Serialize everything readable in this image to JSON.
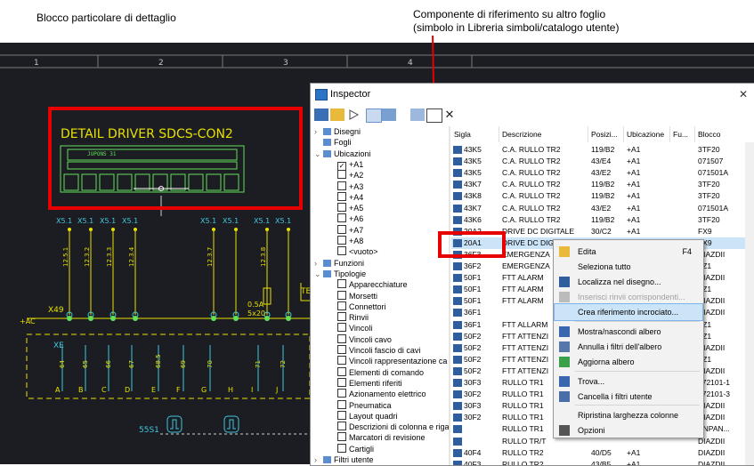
{
  "callouts": {
    "left": "Blocco particolare di dettaglio",
    "right_line1": "Componente di riferimento su altro foglio",
    "right_line2": "(simbolo in Libreria simboli/catalogo utente)"
  },
  "cad": {
    "ruler": [
      "1",
      "2",
      "3",
      "4"
    ],
    "detail_title": "DETAIL DRIVER SDCS-CON2",
    "detail_sub": [
      "JUPONS 31",
      "0.1",
      "16-11",
      "10.17",
      "16-1"
    ],
    "terminal_tags": [
      "X5.1",
      "X5.1",
      "X5.1",
      "X5.1",
      "X5.1",
      "X5.1",
      "X5.1",
      "X5.1"
    ],
    "wire_nums": [
      "12.5.1",
      "12.3.2",
      "12.3.3",
      "12.3.4",
      "12.3.7",
      "12.3.8"
    ],
    "x49": "X49",
    "xe": "XE",
    "ac": "+AC",
    "bot_nums": [
      "64",
      "65",
      "66",
      "67",
      "68.5",
      "69",
      "70",
      "71",
      "72"
    ],
    "bot_letters": [
      "A",
      "B",
      "C",
      "D",
      "E",
      "F",
      "G",
      "H",
      "I",
      "J"
    ],
    "fuse_label1": "0.5A",
    "fuse_label2": "5x20",
    "relay": "55S1",
    "side_te": "TE",
    "side_54": "54"
  },
  "inspector": {
    "title": "Inspector",
    "close": "✕",
    "tree": [
      {
        "label": "Disegni",
        "indent": 0,
        "exp": "›"
      },
      {
        "label": "Fogli",
        "indent": 0,
        "exp": ""
      },
      {
        "label": "Ubicazioni",
        "indent": 0,
        "exp": "⌄"
      },
      {
        "label": "+A1",
        "indent": 1,
        "checked": true
      },
      {
        "label": "+A2",
        "indent": 1
      },
      {
        "label": "+A3",
        "indent": 1
      },
      {
        "label": "+A4",
        "indent": 1
      },
      {
        "label": "+A5",
        "indent": 1
      },
      {
        "label": "+A6",
        "indent": 1
      },
      {
        "label": "+A7",
        "indent": 1
      },
      {
        "label": "+A8",
        "indent": 1
      },
      {
        "label": "<vuoto>",
        "indent": 1
      },
      {
        "label": "Funzioni",
        "indent": 0,
        "exp": "›"
      },
      {
        "label": "Tipologie",
        "indent": 0,
        "exp": "⌄"
      },
      {
        "label": "Apparecchiature",
        "indent": 1
      },
      {
        "label": "Morsetti",
        "indent": 1
      },
      {
        "label": "Connettori",
        "indent": 1
      },
      {
        "label": "Rinvii",
        "indent": 1
      },
      {
        "label": "Vincoli",
        "indent": 1
      },
      {
        "label": "Vincoli cavo",
        "indent": 1
      },
      {
        "label": "Vincoli fascio di cavi",
        "indent": 1
      },
      {
        "label": "Vincoli rappresentazione ca",
        "indent": 1
      },
      {
        "label": "Elementi di comando",
        "indent": 1
      },
      {
        "label": "Elementi riferiti",
        "indent": 1
      },
      {
        "label": "Azionamento elettrico",
        "indent": 1
      },
      {
        "label": "Pneumatica",
        "indent": 1
      },
      {
        "label": "Layout quadri",
        "indent": 1
      },
      {
        "label": "Descrizioni di colonna e riga",
        "indent": 1
      },
      {
        "label": "Marcatori di revisione",
        "indent": 1
      },
      {
        "label": "Cartigli",
        "indent": 1
      },
      {
        "label": "Filtri utente",
        "indent": 0,
        "exp": "›"
      }
    ],
    "columns": [
      "Sigla",
      "Descrizione",
      "Posizi...",
      "Ubicazione",
      "Fu...",
      "Blocco"
    ],
    "rows": [
      [
        "43K5",
        "C.A. RULLO TR2",
        "119/B2",
        "+A1",
        "",
        "3TF20"
      ],
      [
        "43K5",
        "C.A. RULLO TR2",
        "43/E4",
        "+A1",
        "",
        "071507"
      ],
      [
        "43K5",
        "C.A. RULLO TR2",
        "43/E2",
        "+A1",
        "",
        "071501A"
      ],
      [
        "43K7",
        "C.A. RULLO TR2",
        "119/B2",
        "+A1",
        "",
        "3TF20"
      ],
      [
        "43K8",
        "C.A. RULLO TR2",
        "119/B2",
        "+A1",
        "",
        "3TF20"
      ],
      [
        "43K7",
        "C.A. RULLO TR2",
        "43/E2",
        "+A1",
        "",
        "071501A"
      ],
      [
        "43K6",
        "C.A. RULLO TR2",
        "119/B2",
        "+A1",
        "",
        "3TF20"
      ],
      [
        "20A2",
        "DRIVE DC DIGITALE",
        "30/C2",
        "+A1",
        "",
        "FX9"
      ],
      [
        "20A1",
        "DRIVE DC DIG",
        "",
        "",
        "",
        "FX9"
      ],
      [
        "36F3",
        "EMERGENZA",
        "",
        "",
        "",
        "DIAZDII"
      ],
      [
        "36F2",
        "EMERGENZA",
        "",
        "",
        "",
        "FZ1"
      ],
      [
        "50F1",
        "FTT ALARM",
        "",
        "",
        "",
        "DIAZDII"
      ],
      [
        "50F1",
        "FTT ALARM",
        "",
        "",
        "",
        "FZ1"
      ],
      [
        "50F1",
        "FTT ALARM",
        "",
        "",
        "",
        "DIAZDII"
      ],
      [
        "36F1",
        "",
        "",
        "",
        "",
        "DIAZDII"
      ],
      [
        "36F1",
        "FTT ALLARM",
        "",
        "",
        "",
        "FZ1"
      ],
      [
        "50F2",
        "FTT ATTENZI",
        "",
        "",
        "",
        "FZ1"
      ],
      [
        "50F2",
        "FTT ATTENZI",
        "",
        "",
        "",
        "DIAZDII"
      ],
      [
        "50F2",
        "FTT ATTENZI",
        "",
        "",
        "",
        "FZ1"
      ],
      [
        "50F2",
        "FTT ATTENZI",
        "",
        "",
        "",
        "DIAZDII"
      ],
      [
        "30F3",
        "RULLO TR1",
        "",
        "",
        "",
        "072101-1"
      ],
      [
        "30F2",
        "RULLO TR1",
        "",
        "",
        "",
        "072101-3"
      ],
      [
        "30F3",
        "RULLO TR1",
        "",
        "",
        "",
        "DIAZDII"
      ],
      [
        "30F2",
        "RULLO TR1",
        "",
        "",
        "",
        "DIAZDII"
      ],
      [
        "",
        "RULLO TR1",
        "",
        "",
        "",
        "SNPAN..."
      ],
      [
        "",
        "RULLO TR/T",
        "",
        "",
        "",
        "DIAZDII"
      ],
      [
        "40F4",
        "RULLO TR2",
        "40/D5",
        "+A1",
        "",
        "DIAZDII"
      ],
      [
        "40F3",
        "RULLO TR2",
        "43/B5",
        "+A1",
        "",
        "DIAZDII"
      ],
      [
        "40F3",
        "RULLO TR2",
        "",
        "",
        "",
        "DIAZDII"
      ]
    ],
    "menu": [
      {
        "label": "Edita",
        "shortcut": "F4",
        "icon": "edit-icon",
        "enabled": true
      },
      {
        "label": "Seleziona tutto",
        "shortcut": "",
        "icon": "",
        "enabled": true
      },
      {
        "label": "Localizza nel disegno...",
        "shortcut": "",
        "icon": "locate-icon",
        "enabled": true
      },
      {
        "label": "Inserisci rinvii corrispondenti...",
        "shortcut": "",
        "icon": "insert-link-icon",
        "enabled": false
      },
      {
        "label": "Crea riferimento incrociato...",
        "shortcut": "",
        "icon": "",
        "enabled": true,
        "highlighted": true
      },
      {
        "label": "Mostra/nascondi albero",
        "shortcut": "",
        "icon": "tree-icon",
        "enabled": true
      },
      {
        "label": "Annulla i filtri dell'albero",
        "shortcut": "",
        "icon": "clear-tree-filter-icon",
        "enabled": true
      },
      {
        "label": "Aggiorna albero",
        "shortcut": "",
        "icon": "refresh-icon",
        "enabled": true
      },
      {
        "label": "Trova...",
        "shortcut": "",
        "icon": "find-icon",
        "enabled": true
      },
      {
        "label": "Cancella i filtri utente",
        "shortcut": "",
        "icon": "clear-filter-icon",
        "enabled": true
      },
      {
        "label": "Ripristina larghezza colonne",
        "shortcut": "",
        "icon": "",
        "enabled": true
      },
      {
        "label": "Opzioni",
        "shortcut": "",
        "icon": "options-icon",
        "enabled": true
      }
    ]
  },
  "colors": {
    "cad_bg": "#1b1d22",
    "callout_red": "#e60000",
    "cad_yellow": "#e8e000",
    "cad_green": "#63e05a",
    "cad_cyan": "#40c8e0",
    "highlight": "#cce4f7"
  }
}
